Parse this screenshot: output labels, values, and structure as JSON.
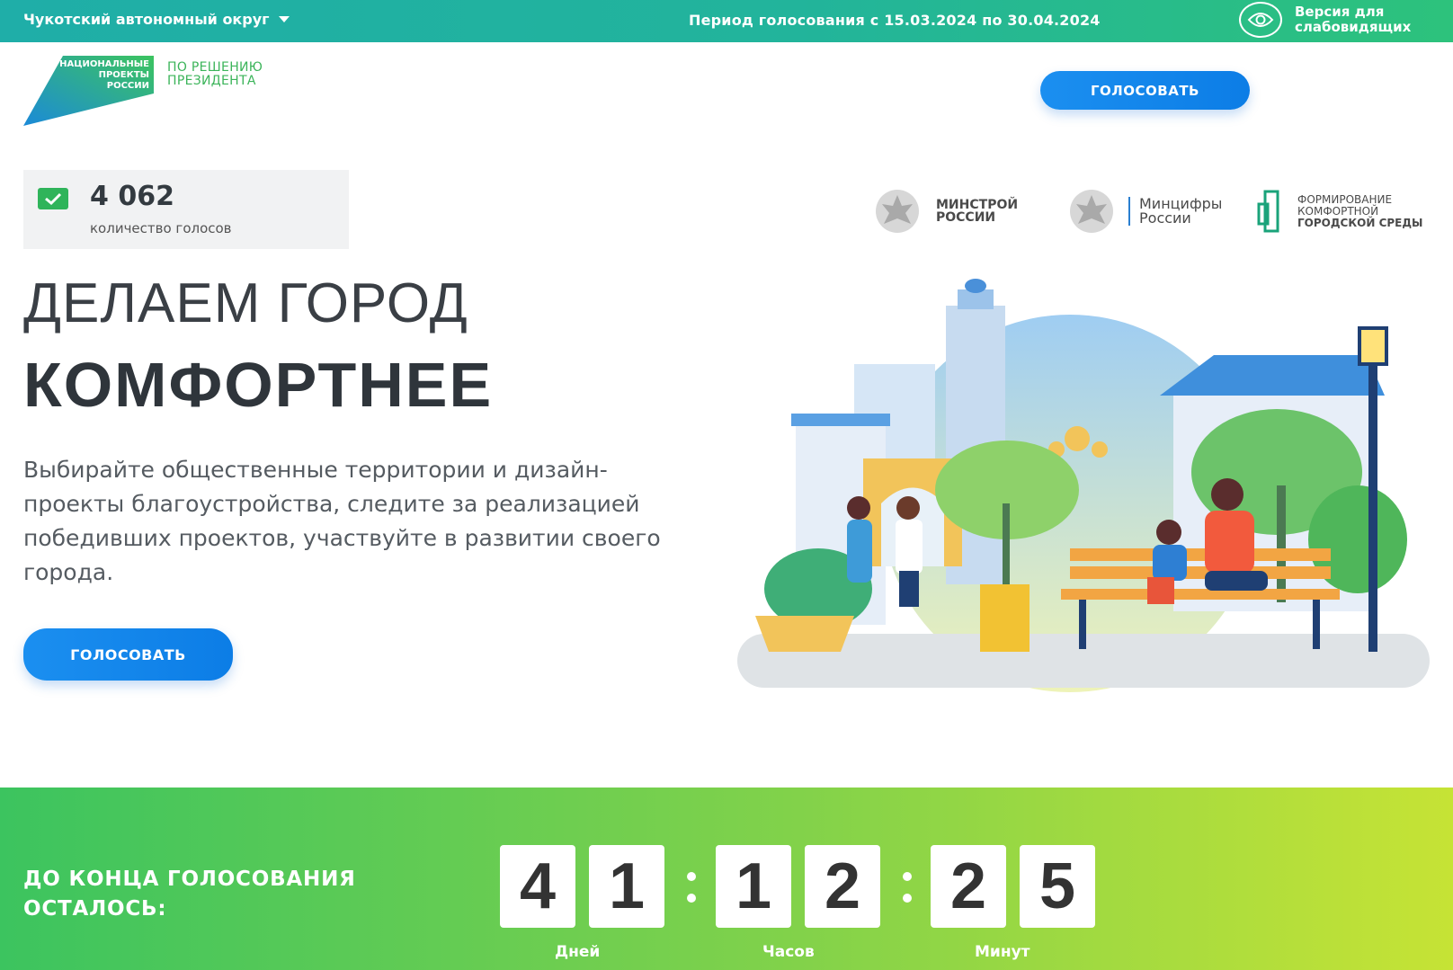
{
  "topbar": {
    "region": "Чукотский автономный округ",
    "period": "Период голосования с 15.03.2024 по 30.04.2024",
    "vision_label": "Версия для слабовидящих"
  },
  "logo": {
    "badge_text": "НАЦИОНАЛЬНЫЕ ПРОЕКТЫ РОССИИ",
    "subtitle_line1": "ПО РЕШЕНИЮ",
    "subtitle_line2": "ПРЕЗИДЕНТА"
  },
  "header": {
    "vote_button": "ГОЛОСОВАТЬ"
  },
  "votes": {
    "count": "4 062",
    "label": "количество голосов"
  },
  "partners": [
    {
      "line1": "МИНСТРОЙ",
      "line2": "РОССИИ"
    },
    {
      "line1": "Минцифры",
      "line2": "России"
    },
    {
      "line1": "ФОРМИРОВАНИЕ",
      "line2": "КОМФОРТНОЙ",
      "line3": "ГОРОДСКОЙ СРЕДЫ"
    }
  ],
  "hero": {
    "title_line1": "ДЕЛАЕМ ГОРОД",
    "title_line2": "КОМФОРТНЕЕ",
    "description": "Выбирайте общественные территории и дизайн-проекты благоустройства, следите за реализацией победивших проектов, участвуйте в развитии своего города.",
    "vote_button": "ГОЛОСОВАТЬ"
  },
  "countdown": {
    "title_line1": "ДО КОНЦА ГОЛОСОВАНИЯ",
    "title_line2": "ОСТАЛОСЬ:",
    "days": [
      "4",
      "1"
    ],
    "hours": [
      "1",
      "2"
    ],
    "minutes": [
      "2",
      "5"
    ],
    "days_label": "Дней",
    "hours_label": "Часов",
    "minutes_label": "Минут"
  },
  "colors": {
    "topbar_start": "#1faea8",
    "topbar_end": "#2dc27c",
    "button_blue": "#1b8ff0",
    "countdown_start": "#3cc45f",
    "countdown_end": "#c6e335"
  }
}
